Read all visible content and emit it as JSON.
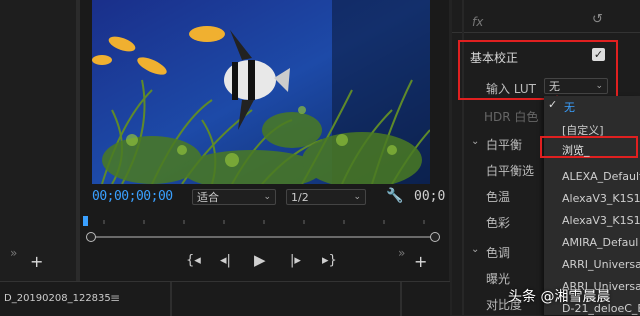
{
  "monitor": {
    "timecode": "00;00;00;00",
    "fit_value": "适合",
    "resolution_value": "1/2",
    "timecode_right": "00;0"
  },
  "bottom": {
    "clip_name": "D_20190208_122835"
  },
  "effects": {
    "fx_label": "fx",
    "basic_correction": "基本校正",
    "input_lut_label": "输入 LUT",
    "input_lut_value": "无",
    "hdr_white": "HDR 白色",
    "white_balance": "白平衡",
    "white_balance_picker": "白平衡选",
    "temperature": "色温",
    "tint": "色彩",
    "tone": "色调",
    "exposure": "曝光",
    "contrast": "对比度"
  },
  "lut_menu": {
    "items": [
      "无",
      "[自定义]",
      "浏览_",
      "ALEXA_Default",
      "AlexaV3_K1S1_",
      "AlexaV3_K1S1_",
      "AMIRA_Defaul",
      "ARRI_Universa",
      "ARRI_Universa",
      "D-21_deloeC_E"
    ]
  },
  "watermark": {
    "text": "头条 @湘雪晨晨"
  },
  "colors": {
    "accent_blue": "#3aa0ff",
    "highlight_red": "#e02020"
  }
}
